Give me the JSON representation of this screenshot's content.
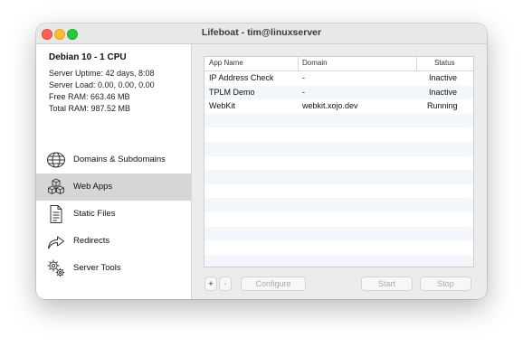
{
  "window": {
    "title": "Lifeboat - tim@linuxserver"
  },
  "server": {
    "name": "Debian 10 - 1 CPU",
    "uptime": "Server Uptime: 42 days, 8:08",
    "load": "Server Load: 0.00, 0.00, 0.00",
    "free_ram": "Free RAM: 663.46 MB",
    "total_ram": "Total RAM: 987.52 MB"
  },
  "sidebar": {
    "items": [
      {
        "label": "Domains & Subdomains",
        "icon": "globe-icon",
        "selected": false
      },
      {
        "label": "Web Apps",
        "icon": "cubes-icon",
        "selected": true
      },
      {
        "label": "Static Files",
        "icon": "document-icon",
        "selected": false
      },
      {
        "label": "Redirects",
        "icon": "redirect-arrow-icon",
        "selected": false
      },
      {
        "label": "Server Tools",
        "icon": "gears-icon",
        "selected": false
      }
    ]
  },
  "table": {
    "columns": [
      "App Name",
      "Domain",
      "Status"
    ],
    "rows": [
      {
        "name": "IP Address Check",
        "domain": "-",
        "status": "Inactive"
      },
      {
        "name": "TPLM Demo",
        "domain": "-",
        "status": "Inactive"
      },
      {
        "name": "WebKit",
        "domain": "webkit.xojo.dev",
        "status": "Running"
      }
    ]
  },
  "toolbar": {
    "add_label": "+",
    "remove_label": "-",
    "configure_label": "Configure",
    "start_label": "Start",
    "stop_label": "Stop"
  },
  "colors": {
    "selection": "#d6d6d6",
    "row_alt": "#f3f6fb",
    "close": "#fe5f57",
    "minimize": "#febc2e",
    "maximize": "#28c840"
  }
}
